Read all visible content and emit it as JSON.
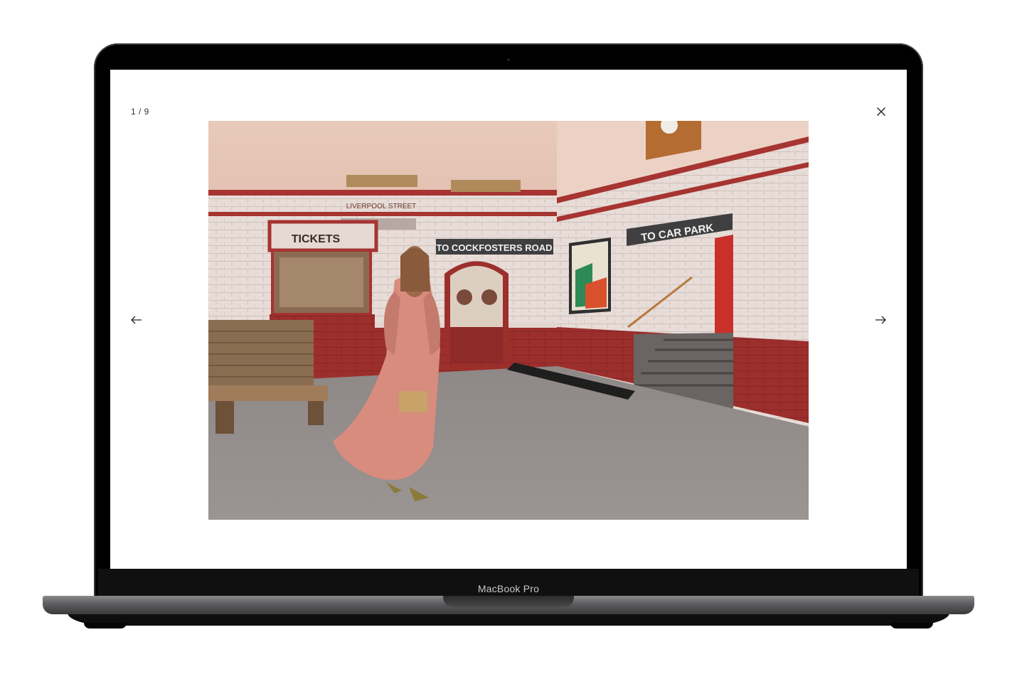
{
  "device": {
    "brand_label": "MacBook Pro"
  },
  "lightbox": {
    "counter": "1 / 9",
    "icons": {
      "close": "close-icon",
      "previous": "arrow-left-icon",
      "next": "arrow-right-icon"
    },
    "photo": {
      "signs": {
        "station": "LIVERPOOL STREET",
        "tickets": "TICKETS",
        "platform": "TO COCKFOSTERS ROAD",
        "parking": "TO CAR PARK"
      }
    }
  }
}
